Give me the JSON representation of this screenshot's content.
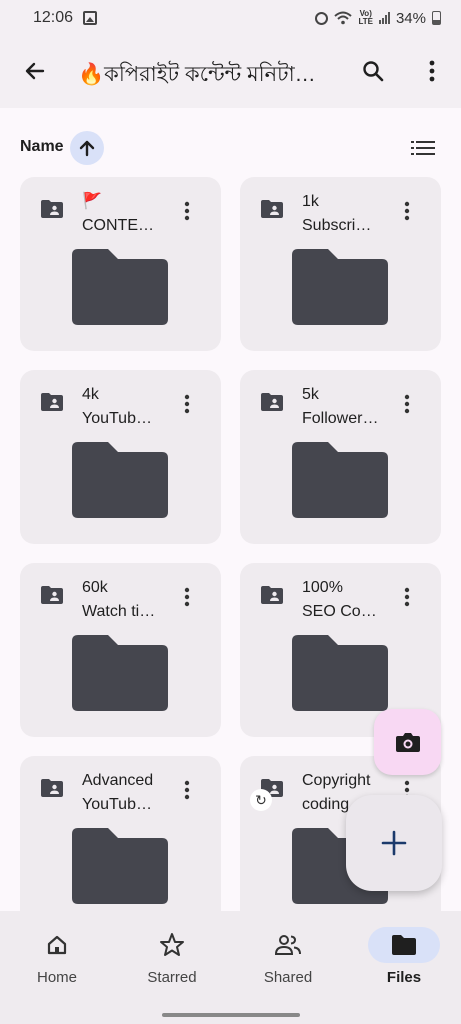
{
  "status_bar": {
    "time": "12:06",
    "battery": "34%",
    "network": "VoLTE"
  },
  "app_bar": {
    "title": "🔥কপিরাইট কন্টেন্ট মনিটা…",
    "back_icon": "arrow-back-icon",
    "search_icon": "search-icon",
    "more_icon": "more-vert-icon"
  },
  "sort": {
    "label": "Name",
    "direction": "ascending"
  },
  "folders": [
    {
      "line1": "🚩",
      "line2": "CONTE…"
    },
    {
      "line1": "1k",
      "line2": "Subscri…"
    },
    {
      "line1": "4k",
      "line2": "YouTub…"
    },
    {
      "line1": "5k",
      "line2": "Follower…"
    },
    {
      "line1": "60k",
      "line2": "Watch ti…"
    },
    {
      "line1": "100%",
      "line2": "SEO Co…"
    },
    {
      "line1": "Advanced",
      "line2": "YouTub…"
    },
    {
      "line1": "Copyright",
      "line2": "coding…"
    }
  ],
  "bottom_nav": [
    {
      "label": "Home",
      "icon": "home-icon"
    },
    {
      "label": "Starred",
      "icon": "star-icon"
    },
    {
      "label": "Shared",
      "icon": "shared-icon"
    },
    {
      "label": "Files",
      "icon": "folder-icon",
      "active": true
    }
  ],
  "colors": {
    "folder": "#45464e",
    "accent_pill": "#d9e1f8",
    "camera_fab": "#f8d8f3"
  }
}
